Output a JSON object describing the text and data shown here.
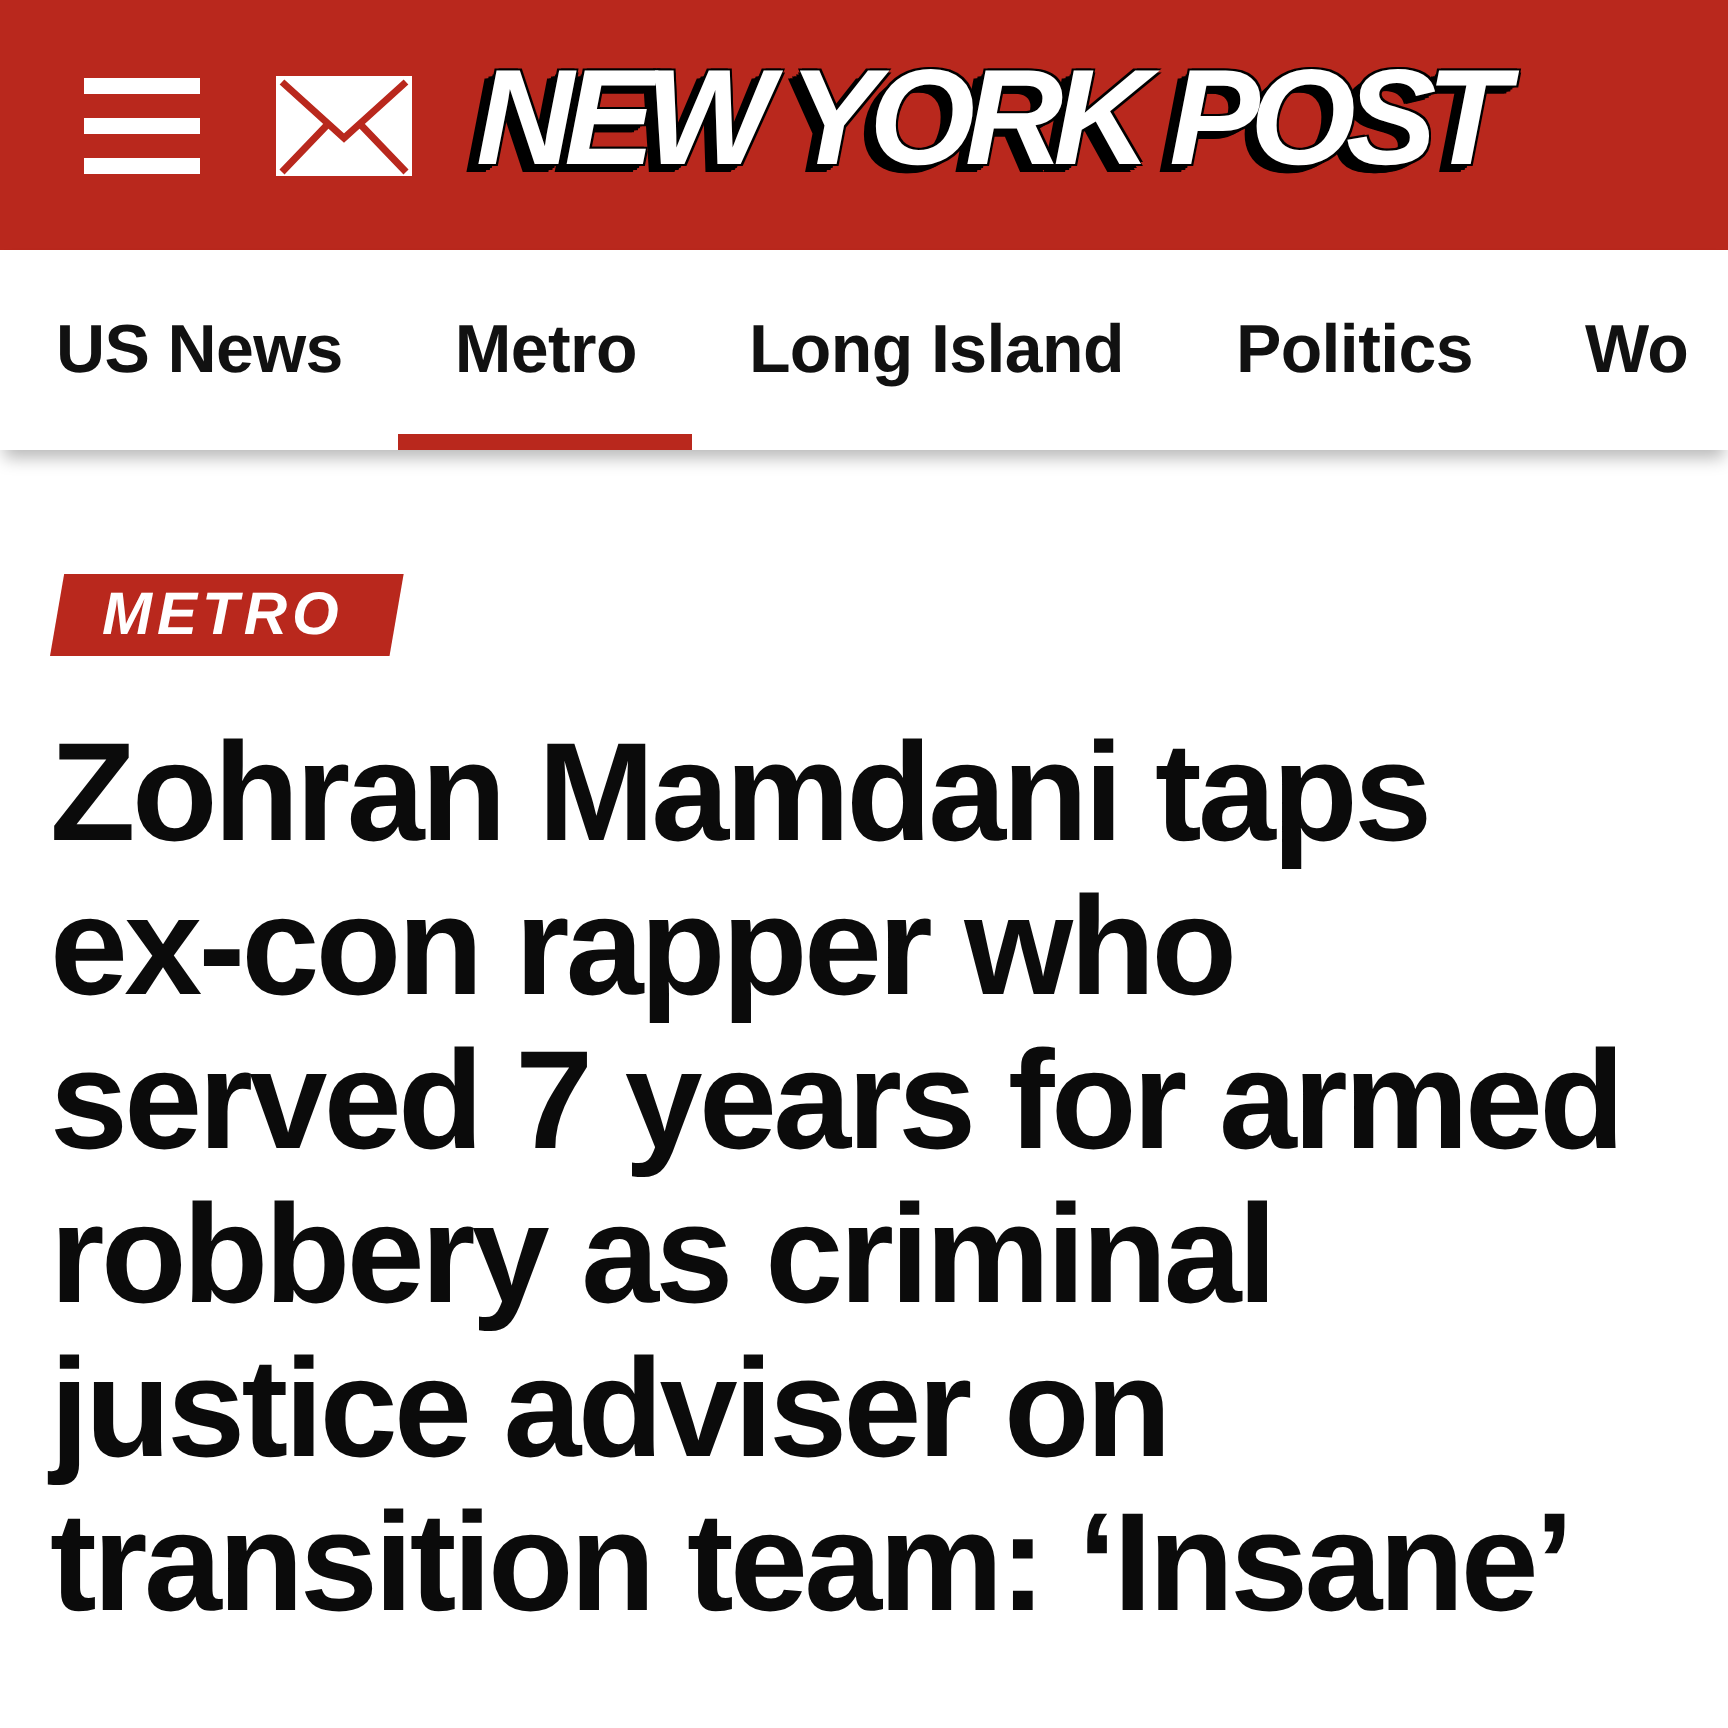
{
  "header": {
    "logo": "NEW YORK POST"
  },
  "nav": {
    "items": [
      {
        "label": "US News",
        "selected": false
      },
      {
        "label": "Metro",
        "selected": true
      },
      {
        "label": "Long Island",
        "selected": false
      },
      {
        "label": "Politics",
        "selected": false
      },
      {
        "label": "Wo",
        "selected": false
      }
    ]
  },
  "article": {
    "section_tag": "METRO",
    "headline": "Zohran Mamdani taps ex-con rapper who served 7 years for armed robbery as criminal justice adviser on transition team: ‘Insane’"
  }
}
